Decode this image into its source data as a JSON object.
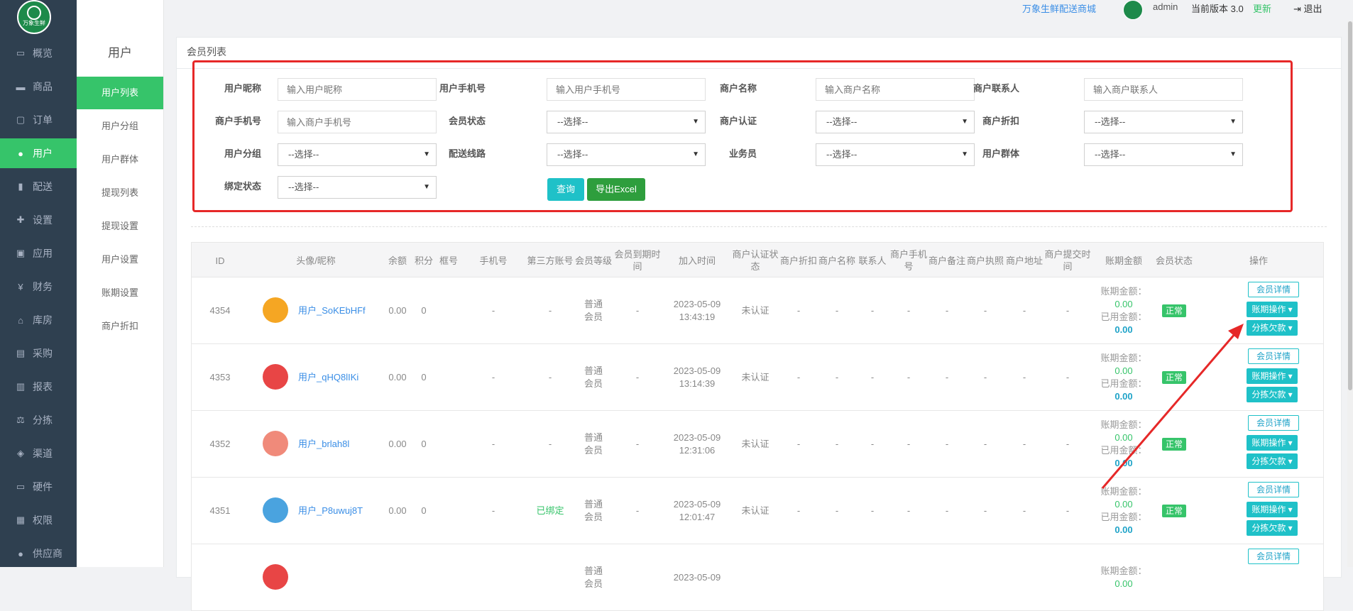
{
  "sidebar": {
    "logo_text": "万象生鲜",
    "items": [
      {
        "label": "概览",
        "icon": "monitor-icon",
        "glyph": "▭"
      },
      {
        "label": "商品",
        "icon": "cart-icon",
        "glyph": "▬"
      },
      {
        "label": "订单",
        "icon": "order-icon",
        "glyph": "▢"
      },
      {
        "label": "用户",
        "icon": "users-icon",
        "glyph": "●"
      },
      {
        "label": "配送",
        "icon": "truck-icon",
        "glyph": "▮"
      },
      {
        "label": "设置",
        "icon": "puzzle-icon",
        "glyph": "✚"
      },
      {
        "label": "应用",
        "icon": "apps-icon",
        "glyph": "▣"
      },
      {
        "label": "财务",
        "icon": "yen-icon",
        "glyph": "¥"
      },
      {
        "label": "库房",
        "icon": "home-icon",
        "glyph": "⌂"
      },
      {
        "label": "采购",
        "icon": "bus-icon",
        "glyph": "▤"
      },
      {
        "label": "报表",
        "icon": "chart-icon",
        "glyph": "▥"
      },
      {
        "label": "分拣",
        "icon": "scale-icon",
        "glyph": "⚖"
      },
      {
        "label": "渠道",
        "icon": "cube-icon",
        "glyph": "◈"
      },
      {
        "label": "硬件",
        "icon": "desktop-icon",
        "glyph": "▭"
      },
      {
        "label": "权限",
        "icon": "bank-icon",
        "glyph": "▦"
      },
      {
        "label": "供应商",
        "icon": "group-icon",
        "glyph": "●"
      }
    ]
  },
  "subnav": {
    "title": "用户",
    "items": [
      "用户列表",
      "用户分组",
      "用户群体",
      "提现列表",
      "提现设置",
      "用户设置",
      "账期设置",
      "商户折扣"
    ]
  },
  "topbar": {
    "shop_name": "万象生鲜配送商城",
    "user": "admin",
    "version": "当前版本 3.0",
    "update": "更新",
    "logout": "⇥ 退出"
  },
  "panel": {
    "title": "会员列表"
  },
  "filters": {
    "nickname": {
      "label": "用户昵称",
      "placeholder": "输入用户昵称"
    },
    "phone": {
      "label": "用户手机号",
      "placeholder": "输入用户手机号"
    },
    "merchant_name": {
      "label": "商户名称",
      "placeholder": "输入商户名称"
    },
    "merchant_contact": {
      "label": "商户联系人",
      "placeholder": "输入商户联系人"
    },
    "merchant_phone": {
      "label": "商户手机号",
      "placeholder": "输入商户手机号"
    },
    "member_status": {
      "label": "会员状态",
      "value": "--选择--"
    },
    "merchant_cert": {
      "label": "商户认证",
      "value": "--选择--"
    },
    "merchant_discount": {
      "label": "商户折扣",
      "value": "--选择--"
    },
    "user_group": {
      "label": "用户分组",
      "value": "--选择--"
    },
    "route": {
      "label": "配送线路",
      "value": "--选择--"
    },
    "salesman": {
      "label": "业务员",
      "value": "--选择--"
    },
    "user_crowd": {
      "label": "用户群体",
      "value": "--选择--"
    },
    "bind_status": {
      "label": "绑定状态",
      "value": "--选择--"
    },
    "query_label": "查询",
    "export_label": "导出Excel"
  },
  "table": {
    "headers": [
      "ID",
      "头像/昵称",
      "余额",
      "积分",
      "框号",
      "手机号",
      "第三方账号",
      "会员等级",
      "会员到期时间",
      "加入时间",
      "商户认证状态",
      "商户折扣",
      "商户名称",
      "联系人",
      "商户手机号",
      "商户备注",
      "商户执照",
      "商户地址",
      "商户提交时间",
      "账期金额",
      "会员状态",
      "操作"
    ],
    "rows": [
      {
        "id": "4354",
        "name": "用户_SoKEbHFf",
        "balance": "0.00",
        "points": "0",
        "box": "",
        "phone": "-",
        "third": "-",
        "level": "普通会员",
        "expire": "-",
        "join_date": "2023-05-09",
        "join_time": "13:43:19",
        "cert": "未认证",
        "discount": "-",
        "mname": "-",
        "contact": "-",
        "mphone": "-",
        "remark": "-",
        "license": "-",
        "addr": "-",
        "submit": "-",
        "period_label": "账期金额：",
        "period_val": "0.00",
        "used_label": "已用金额：",
        "used_val": "0.00",
        "status": "正常",
        "avatar_color": "#f5a623"
      },
      {
        "id": "4353",
        "name": "用户_qHQ8lIKi",
        "balance": "0.00",
        "points": "0",
        "box": "",
        "phone": "-",
        "third": "-",
        "level": "普通会员",
        "expire": "-",
        "join_date": "2023-05-09",
        "join_time": "13:14:39",
        "cert": "未认证",
        "discount": "-",
        "mname": "-",
        "contact": "-",
        "mphone": "-",
        "remark": "-",
        "license": "-",
        "addr": "-",
        "submit": "-",
        "period_label": "账期金额：",
        "period_val": "0.00",
        "used_label": "已用金额：",
        "used_val": "0.00",
        "status": "正常",
        "avatar_color": "#e84545"
      },
      {
        "id": "4352",
        "name": "用户_brlah8l",
        "balance": "0.00",
        "points": "0",
        "box": "",
        "phone": "-",
        "third": "-",
        "level": "普通会员",
        "expire": "-",
        "join_date": "2023-05-09",
        "join_time": "12:31:06",
        "cert": "未认证",
        "discount": "-",
        "mname": "-",
        "contact": "-",
        "mphone": "-",
        "remark": "-",
        "license": "-",
        "addr": "-",
        "submit": "-",
        "period_label": "账期金额：",
        "period_val": "0.00",
        "used_label": "已用金额：",
        "used_val": "0.00",
        "status": "正常",
        "avatar_color": "#f08a7a"
      },
      {
        "id": "4351",
        "name": "用户_P8uwuj8T",
        "balance": "0.00",
        "points": "0",
        "box": "",
        "phone": "-",
        "third": "已绑定",
        "level": "普通会员",
        "expire": "-",
        "join_date": "2023-05-09",
        "join_time": "12:01:47",
        "cert": "未认证",
        "discount": "-",
        "mname": "-",
        "contact": "-",
        "mphone": "-",
        "remark": "-",
        "license": "-",
        "addr": "-",
        "submit": "-",
        "period_label": "账期金额：",
        "period_val": "0.00",
        "used_label": "已用金额：",
        "used_val": "0.00",
        "status": "正常",
        "avatar_color": "#4aa3df"
      },
      {
        "id": "",
        "name": "",
        "balance": "",
        "points": "",
        "box": "",
        "phone": "",
        "third": "",
        "level": "普通会员",
        "expire": "",
        "join_date": "2023-05-09",
        "join_time": "",
        "cert": "",
        "discount": "",
        "mname": "",
        "contact": "",
        "mphone": "",
        "remark": "",
        "license": "",
        "addr": "",
        "submit": "",
        "period_label": "账期金额：",
        "period_val": "0.00",
        "used_label": "",
        "used_val": "",
        "status": "",
        "avatar_color": "#e84545"
      }
    ],
    "ops": {
      "detail": "会员详情",
      "period_op": "账期操作 ▾",
      "debt": "分拣欠款 ▾"
    }
  },
  "colors": {
    "accent": "#36c46a",
    "teal": "#1fc1c8",
    "highlight": "#e62828",
    "sidebar": "#2f4050"
  }
}
